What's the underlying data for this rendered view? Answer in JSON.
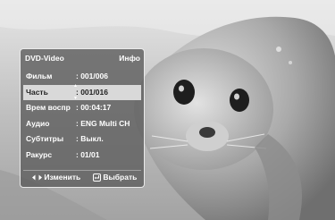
{
  "menu": {
    "title": "DVD-Video",
    "mode": "Инфо",
    "items": [
      {
        "label": "Фильм",
        "value": ": 001/006"
      },
      {
        "label": "Часть",
        "value": ": 001/016"
      },
      {
        "label": "Врем воспр",
        "value": ": 00:04:17"
      },
      {
        "label": "Аудио",
        "value": ": ENG Multi CH"
      },
      {
        "label": "Субтитры",
        "value": ": Выкл."
      },
      {
        "label": "Ракурс",
        "value": ": 01/01"
      }
    ],
    "selected_item": "Часть"
  },
  "footer": {
    "change_label": "Изменить",
    "change_icon": "left-right-arrows-icon",
    "select_label": "Выбрать",
    "select_icon": "enter-button-icon"
  }
}
